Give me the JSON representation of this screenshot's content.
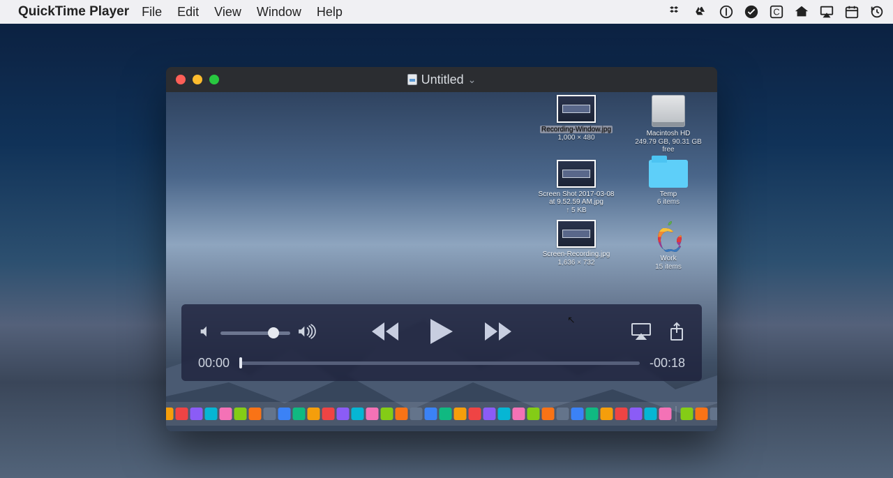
{
  "menubar": {
    "app": "QuickTime Player",
    "items": [
      "File",
      "Edit",
      "View",
      "Window",
      "Help"
    ]
  },
  "tray": {
    "items": [
      "dropbox-icon",
      "google-drive-icon",
      "one-password-icon",
      "check-icon",
      "caffeine-icon",
      "sync-home-icon",
      "airplay-icon",
      "calendar-icon",
      "time-machine-icon"
    ]
  },
  "window": {
    "title": "Untitled"
  },
  "desktop_icons": [
    {
      "name": "Recording-Window.jpg",
      "sub": "1,000 × 480",
      "kind": "image-thumb",
      "highlighted": true
    },
    {
      "name": "Macintosh HD",
      "sub": "249.79 GB, 90.31 GB free",
      "kind": "drive"
    },
    {
      "name": "Screen Shot 2017-03-08 at 9.52.59 AM.jpg",
      "sub": "↑ 5 KB",
      "kind": "image-thumb"
    },
    {
      "name": "Temp",
      "sub": "6 items",
      "kind": "folder"
    },
    {
      "name": "Screen-Recording.jpg",
      "sub": "1,636 × 732",
      "kind": "image-thumb"
    },
    {
      "name": "Work",
      "sub": "15 items",
      "kind": "apple"
    }
  ],
  "playback": {
    "time_elapsed": "00:00",
    "time_remaining": "-00:18"
  },
  "dock_count": 42,
  "colors": {
    "accent": "#cfd5e0"
  }
}
